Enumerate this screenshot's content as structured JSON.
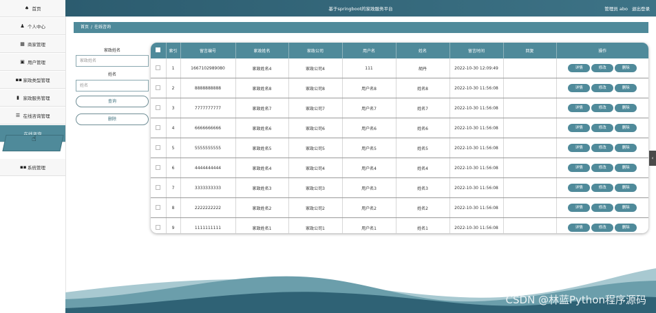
{
  "sidebar": {
    "items": [
      {
        "label": "首页",
        "icon": "home-icon",
        "glyph": "♠"
      },
      {
        "label": "个人中心",
        "icon": "user-icon",
        "glyph": "♟"
      },
      {
        "label": "商家管理",
        "icon": "grid-icon",
        "glyph": "▦"
      },
      {
        "label": "用户管理",
        "icon": "card-icon",
        "glyph": "▣"
      },
      {
        "label": "家政类型管理",
        "icon": "apps-icon",
        "glyph": "▪▪"
      },
      {
        "label": "家政服务管理",
        "icon": "chart-icon",
        "glyph": "▮"
      },
      {
        "label": "在线咨询管理",
        "icon": "list-icon",
        "glyph": "☰"
      },
      {
        "label": "在线咨询",
        "icon": "",
        "glyph": ""
      },
      {
        "label": "系统管理",
        "icon": "apps-icon",
        "glyph": "▪▪"
      }
    ]
  },
  "header": {
    "title": "基于springboot的家政服务平台",
    "user_label": "管理员 abo",
    "logout": "退出登录"
  },
  "breadcrumb": {
    "home": "首页",
    "separator": "/",
    "current": "在线咨询"
  },
  "search": {
    "name_label": "家政姓名",
    "name_placeholder": "家政姓名",
    "person_label": "姓名",
    "person_placeholder": "姓名",
    "query_button": "查询",
    "delete_button": "删除"
  },
  "table": {
    "headers": [
      "",
      "索引",
      "留言编号",
      "家政姓名",
      "家政公司",
      "用户名",
      "姓名",
      "留言时间",
      "回复",
      "操作"
    ],
    "actions": {
      "detail": "详情",
      "edit": "修改",
      "delete": "删除"
    },
    "rows": [
      {
        "index": "1",
        "msg_no": "1667102989080",
        "staff": "家政姓名4",
        "company": "家政公司4",
        "username": "111",
        "name": "胡丹",
        "time": "2022-10-30 12:09:49",
        "reply": ""
      },
      {
        "index": "2",
        "msg_no": "8888888888",
        "staff": "家政姓名8",
        "company": "家政公司8",
        "username": "用户名8",
        "name": "姓名8",
        "time": "2022-10-30 11:56:08",
        "reply": ""
      },
      {
        "index": "3",
        "msg_no": "7777777777",
        "staff": "家政姓名7",
        "company": "家政公司7",
        "username": "用户名7",
        "name": "姓名7",
        "time": "2022-10-30 11:56:08",
        "reply": ""
      },
      {
        "index": "4",
        "msg_no": "6666666666",
        "staff": "家政姓名6",
        "company": "家政公司6",
        "username": "用户名6",
        "name": "姓名6",
        "time": "2022-10-30 11:56:08",
        "reply": ""
      },
      {
        "index": "5",
        "msg_no": "5555555555",
        "staff": "家政姓名5",
        "company": "家政公司5",
        "username": "用户名5",
        "name": "姓名5",
        "time": "2022-10-30 11:56:08",
        "reply": ""
      },
      {
        "index": "6",
        "msg_no": "4444444444",
        "staff": "家政姓名4",
        "company": "家政公司4",
        "username": "用户名4",
        "name": "姓名4",
        "time": "2022-10-30 11:56:08",
        "reply": ""
      },
      {
        "index": "7",
        "msg_no": "3333333333",
        "staff": "家政姓名3",
        "company": "家政公司3",
        "username": "用户名3",
        "name": "姓名3",
        "time": "2022-10-30 11:56:08",
        "reply": ""
      },
      {
        "index": "8",
        "msg_no": "2222222222",
        "staff": "家政姓名2",
        "company": "家政公司2",
        "username": "用户名2",
        "name": "姓名2",
        "time": "2022-10-30 11:56:08",
        "reply": ""
      },
      {
        "index": "9",
        "msg_no": "1111111111",
        "staff": "家政姓名1",
        "company": "家政公司1",
        "username": "用户名1",
        "name": "姓名1",
        "time": "2022-10-30 11:56:08",
        "reply": ""
      }
    ]
  },
  "scroll_tab": {
    "glyph": "‹"
  },
  "watermark": "CSDN @林蓝Python程序源码",
  "colors": {
    "accent": "#4f8a9a",
    "topbar": "#2c5c6f"
  }
}
